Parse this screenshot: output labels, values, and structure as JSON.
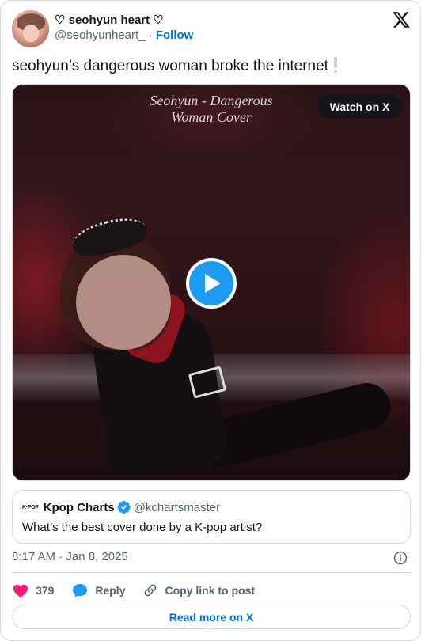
{
  "author": {
    "display_name": "♡ seohyun heart ♡",
    "handle": "@seohyunheart_",
    "separator": " · ",
    "follow_label": "Follow"
  },
  "tweet": {
    "text": "seohyun’s dangerous woman broke the internet"
  },
  "media": {
    "overlay_title_line1": "Seohyun - Dangerous",
    "overlay_title_line2": "Woman Cover",
    "watch_label": "Watch on X"
  },
  "quote": {
    "logo_text": "K·POP",
    "name": "Kpop Charts",
    "handle": "@kchartsmaster",
    "text": "What’s the best cover done by a K-pop artist?"
  },
  "meta": {
    "timestamp": "8:17 AM · Jan 8, 2025"
  },
  "actions": {
    "like_count": "379",
    "reply_label": "Reply",
    "copy_label": "Copy link to post"
  },
  "footer": {
    "read_more_label": "Read more on X"
  },
  "colors": {
    "link": "#006fd6",
    "like": "#f91880",
    "play": "#1d9bf0",
    "verified": "#1d9bf0",
    "secondary_text": "#536471"
  }
}
